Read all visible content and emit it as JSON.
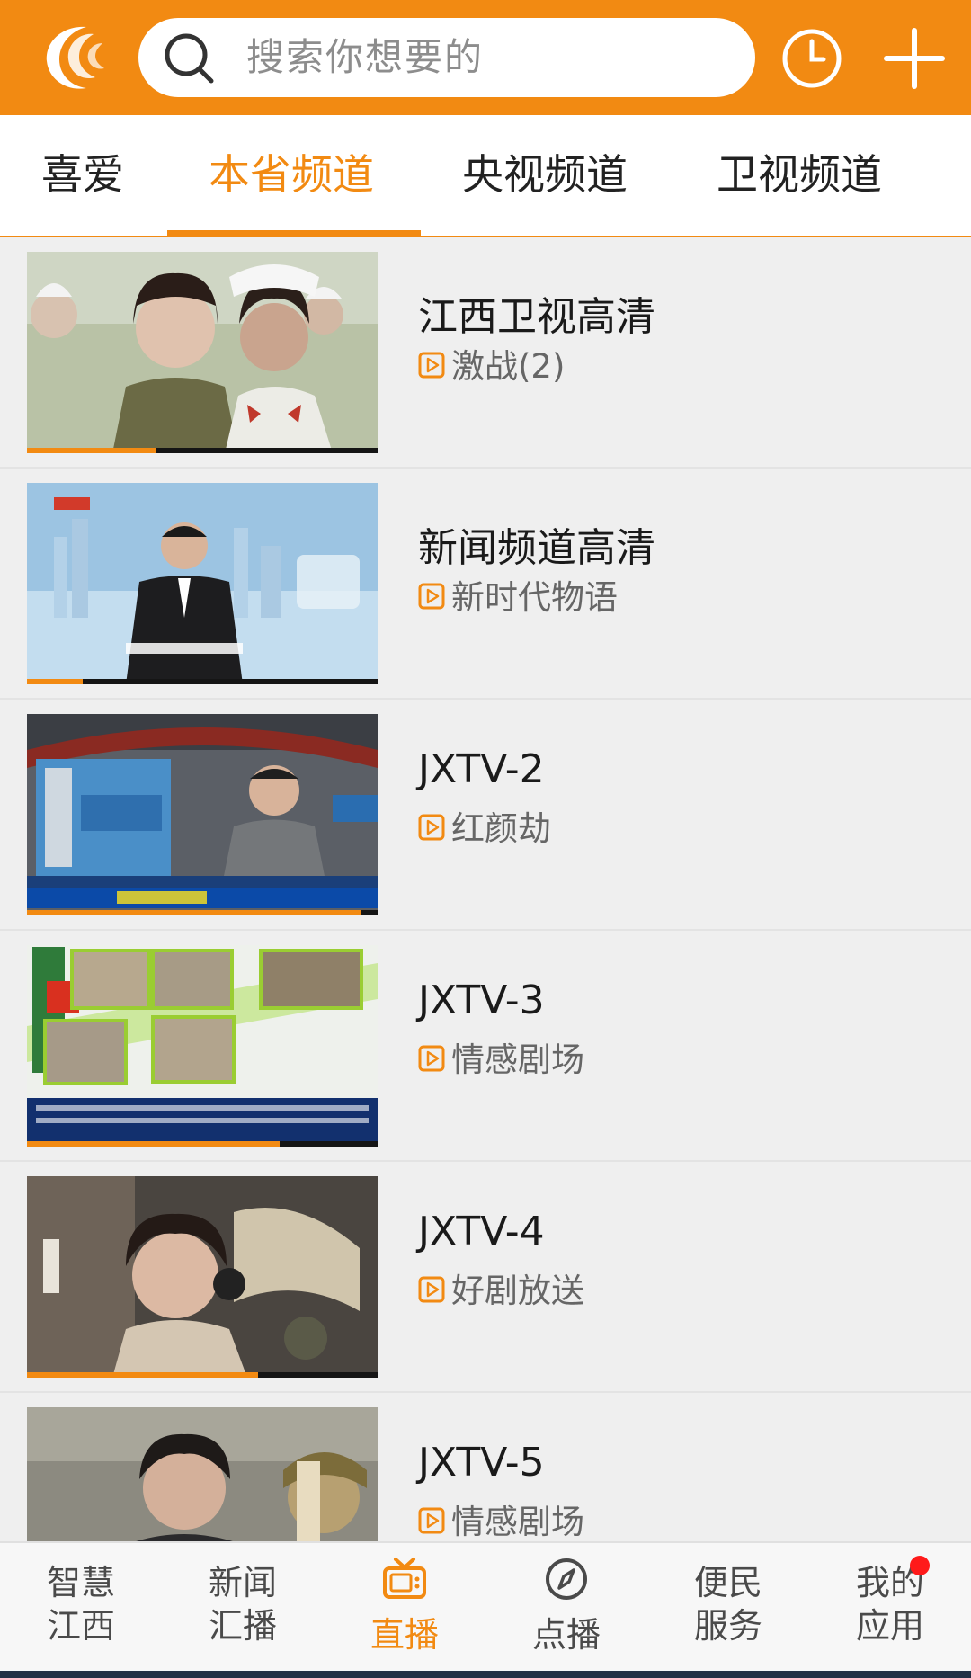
{
  "header": {
    "search_placeholder": "搜索你想要的",
    "accent_color": "#f28a12",
    "icons": [
      "app-logo-icon",
      "search-icon",
      "history-clock-icon",
      "plus-icon"
    ]
  },
  "tabs": [
    {
      "label": "喜爱",
      "active": false
    },
    {
      "label": "本省频道",
      "active": true
    },
    {
      "label": "央视频道",
      "active": false
    },
    {
      "label": "卫视频道",
      "active": false
    }
  ],
  "channels": [
    {
      "name": "江西卫视高清",
      "program": "激战(2)",
      "progress": 0.37
    },
    {
      "name": "新闻频道高清",
      "program": "新时代物语",
      "progress": 0.16
    },
    {
      "name": "JXTV-2",
      "program": "红颜劫",
      "progress": 0.95
    },
    {
      "name": "JXTV-3",
      "program": "情感剧场",
      "progress": 0.72
    },
    {
      "name": "JXTV-4",
      "program": "好剧放送",
      "progress": 0.66
    },
    {
      "name": "JXTV-5",
      "program": "情感剧场",
      "progress": 0.0
    }
  ],
  "bottom_nav": [
    {
      "line1": "智慧",
      "line2": "江西",
      "icon": null,
      "active": false
    },
    {
      "line1": "新闻",
      "line2": "汇播",
      "icon": null,
      "active": false
    },
    {
      "line1": "",
      "line2": "直播",
      "icon": "tv-icon",
      "active": true
    },
    {
      "line1": "",
      "line2": "点播",
      "icon": "compass-icon",
      "active": false
    },
    {
      "line1": "便民",
      "line2": "服务",
      "icon": null,
      "active": false
    },
    {
      "line1": "我的",
      "line2": "应用",
      "icon": null,
      "active": false,
      "badge": "red-dot"
    }
  ]
}
